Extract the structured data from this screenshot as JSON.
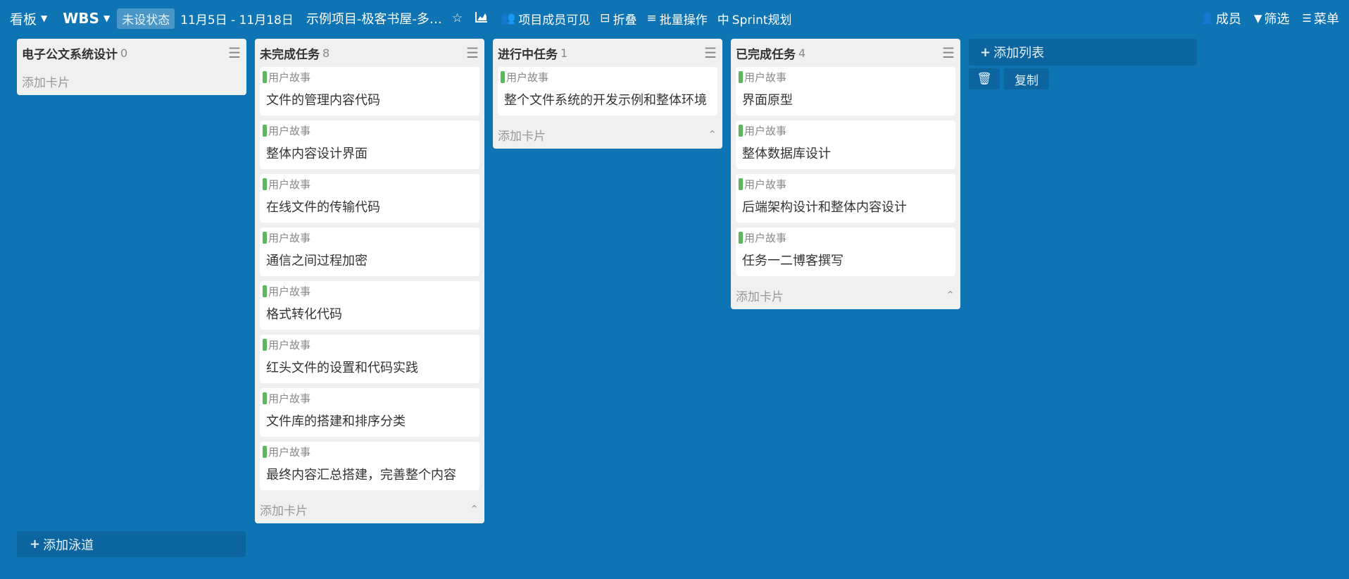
{
  "topbar": {
    "board_label": "看板",
    "wbs_label": "WBS",
    "status": "未设状态",
    "dates": "11月5日 - 11月18日",
    "project": "示例项目-极客书屋-多…",
    "visibility": "项目成员可见",
    "collapse": "折叠",
    "batch": "批量操作",
    "sprint": "Sprint规划",
    "members": "成员",
    "filter": "筛选",
    "menu": "菜单"
  },
  "lists": [
    {
      "title": "电子公文系统设计",
      "count": "0",
      "add_card": "添加卡片",
      "cards": []
    },
    {
      "title": "未完成任务",
      "count": "8",
      "add_card": "添加卡片",
      "cards": [
        {
          "tag": "用户故事",
          "title": "文件的管理内容代码"
        },
        {
          "tag": "用户故事",
          "title": "整体内容设计界面"
        },
        {
          "tag": "用户故事",
          "title": "在线文件的传输代码"
        },
        {
          "tag": "用户故事",
          "title": "通信之间过程加密"
        },
        {
          "tag": "用户故事",
          "title": "格式转化代码"
        },
        {
          "tag": "用户故事",
          "title": "红头文件的设置和代码实践"
        },
        {
          "tag": "用户故事",
          "title": "文件库的搭建和排序分类"
        },
        {
          "tag": "用户故事",
          "title": "最终内容汇总搭建，完善整个内容"
        }
      ]
    },
    {
      "title": "进行中任务",
      "count": "1",
      "add_card": "添加卡片",
      "cards": [
        {
          "tag": "用户故事",
          "title": "整个文件系统的开发示例和整体环境"
        }
      ]
    },
    {
      "title": "已完成任务",
      "count": "4",
      "add_card": "添加卡片",
      "cards": [
        {
          "tag": "用户故事",
          "title": "界面原型"
        },
        {
          "tag": "用户故事",
          "title": "整体数据库设计"
        },
        {
          "tag": "用户故事",
          "title": "后端架构设计和整体内容设计"
        },
        {
          "tag": "用户故事",
          "title": "任务一二博客撰写"
        }
      ]
    }
  ],
  "add_list": "添加列表",
  "copy_label": "复制",
  "add_lane": "添加泳道",
  "colors": {
    "background": "#0e74b4",
    "tag_bar": "#5cb85c",
    "list_bg": "#f0f0f0"
  },
  "icons": [
    "chevron-down-icon",
    "star-icon",
    "chart-icon",
    "users-icon",
    "collapse-icon",
    "list-icon",
    "sprint-icon",
    "user-icon",
    "filter-icon",
    "menu-icon",
    "trash-icon",
    "plus-icon"
  ]
}
